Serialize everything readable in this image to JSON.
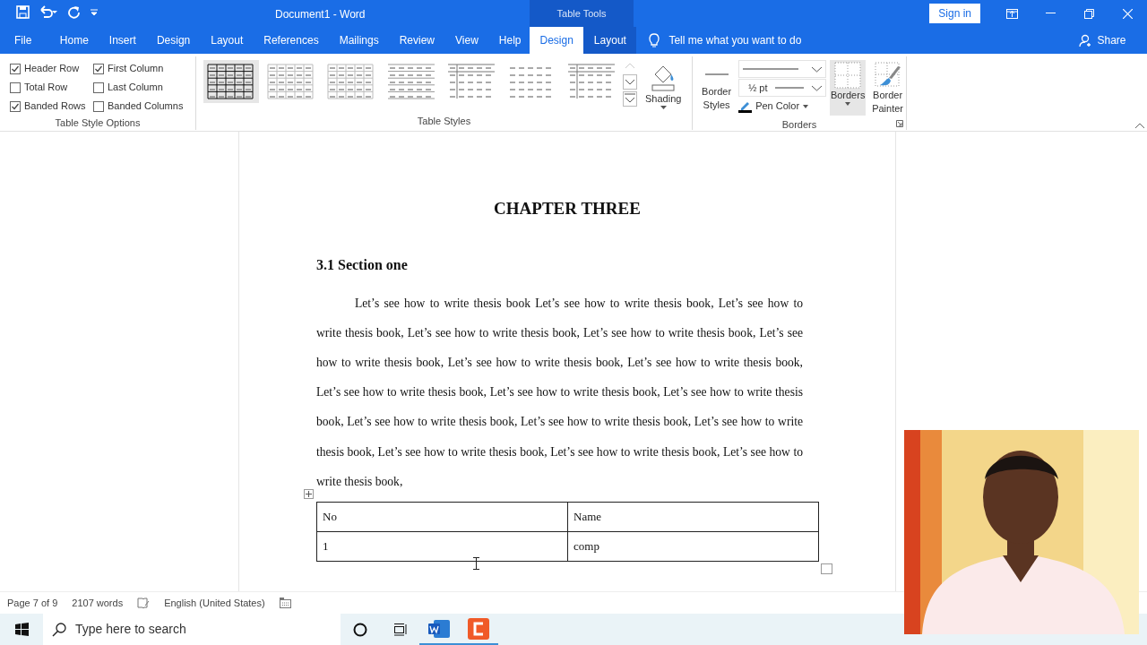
{
  "title_bar": {
    "title": "Document1  -  Word",
    "context_label": "Table Tools",
    "sign_in": "Sign in"
  },
  "tabs": [
    {
      "label": "File",
      "selected": false,
      "kind": "main"
    },
    {
      "label": "Home",
      "selected": false,
      "kind": "main"
    },
    {
      "label": "Insert",
      "selected": false,
      "kind": "main"
    },
    {
      "label": "Design",
      "selected": false,
      "kind": "main"
    },
    {
      "label": "Layout",
      "selected": false,
      "kind": "main"
    },
    {
      "label": "References",
      "selected": false,
      "kind": "main"
    },
    {
      "label": "Mailings",
      "selected": false,
      "kind": "main"
    },
    {
      "label": "Review",
      "selected": false,
      "kind": "main"
    },
    {
      "label": "View",
      "selected": false,
      "kind": "main"
    },
    {
      "label": "Help",
      "selected": false,
      "kind": "main"
    },
    {
      "label": "Design",
      "selected": true,
      "kind": "contextual"
    },
    {
      "label": "Layout",
      "selected": false,
      "kind": "contextual"
    }
  ],
  "tell_me": "Tell me what you want to do",
  "share": "Share",
  "table_style_options": {
    "label": "Table Style Options",
    "options": [
      {
        "label": "Header Row",
        "checked": true
      },
      {
        "label": "First Column",
        "checked": true
      },
      {
        "label": "Total Row",
        "checked": false
      },
      {
        "label": "Last Column",
        "checked": false
      },
      {
        "label": "Banded Rows",
        "checked": true
      },
      {
        "label": "Banded Columns",
        "checked": false
      }
    ]
  },
  "table_styles": {
    "label": "Table Styles",
    "styles": [
      {
        "kind": "grid",
        "selected": true
      },
      {
        "kind": "light-grid",
        "selected": false
      },
      {
        "kind": "light-grid",
        "selected": false
      },
      {
        "kind": "rows",
        "selected": false
      },
      {
        "kind": "first-column",
        "selected": false
      },
      {
        "kind": "plain",
        "selected": false
      },
      {
        "kind": "first-column",
        "selected": false
      }
    ],
    "shading": "Shading"
  },
  "borders": {
    "label": "Borders",
    "border_styles": "Border Styles",
    "weight": "½ pt",
    "pen_color": "Pen Color",
    "borders_button": "Borders",
    "border_painter": "Border Painter"
  },
  "document": {
    "heading": "CHAPTER THREE",
    "section": "3.1 Section one",
    "paragraph": "Let’s see how to write thesis book Let’s see how to write thesis book, Let’s see how to write thesis book, Let’s see how to write thesis book, Let’s see how to write thesis book, Let’s see how to write thesis book, Let’s see how to write thesis book, Let’s see how to write thesis book, Let’s see how to write thesis book, Let’s see how to write thesis book, Let’s see how to write thesis book, Let’s see how to write thesis book, Let’s see how to write thesis book, Let’s see how to write thesis book, Let’s see how to write thesis book, Let’s see how to write thesis book, Let’s see how to write thesis book,",
    "table": {
      "columns": [
        "No",
        "Name"
      ],
      "rows": [
        [
          "1",
          "comp"
        ]
      ]
    }
  },
  "status_bar": {
    "page": "Page 7 of 9",
    "words": "2107 words",
    "language": "English (United States)"
  },
  "taskbar": {
    "search_placeholder": "Type here to search"
  }
}
